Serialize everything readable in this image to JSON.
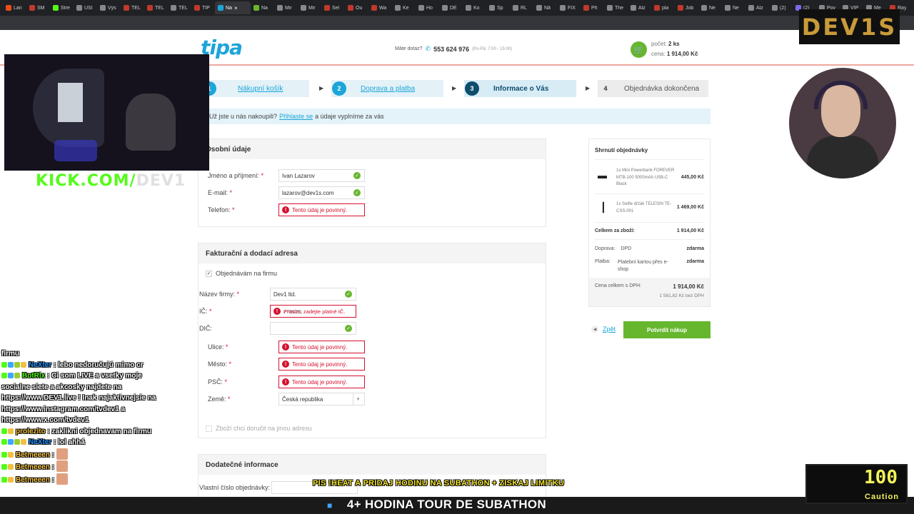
{
  "browser": {
    "tabs": [
      {
        "label": "Lan",
        "color": "#e94e1b"
      },
      {
        "label": "SM",
        "color": "#c0392b"
      },
      {
        "label": "Stre",
        "color": "#53fc18"
      },
      {
        "label": "USI",
        "color": "#888888"
      },
      {
        "label": "Výs",
        "color": "#888888"
      },
      {
        "label": "TEL",
        "color": "#c0392b"
      },
      {
        "label": "TEL",
        "color": "#c0392b"
      },
      {
        "label": "TEL",
        "color": "#888888"
      },
      {
        "label": "TIP",
        "color": "#c0392b"
      },
      {
        "label": "Na",
        "color": "#1ca5d8",
        "active": true
      },
      {
        "label": "Na",
        "color": "#67b72e"
      },
      {
        "label": "Mir",
        "color": "#888888"
      },
      {
        "label": "Mir",
        "color": "#888888"
      },
      {
        "label": "Sel",
        "color": "#c0392b"
      },
      {
        "label": "Ou",
        "color": "#c0392b"
      },
      {
        "label": "Wa",
        "color": "#c0392b"
      },
      {
        "label": "Ke",
        "color": "#888888"
      },
      {
        "label": "Ho",
        "color": "#888888"
      },
      {
        "label": "DE",
        "color": "#888888"
      },
      {
        "label": "Ko",
        "color": "#888888"
      },
      {
        "label": "Sp",
        "color": "#888888"
      },
      {
        "label": "RL",
        "color": "#888888"
      },
      {
        "label": "Nã",
        "color": "#888888"
      },
      {
        "label": "FIX",
        "color": "#888888"
      },
      {
        "label": "Při",
        "color": "#c0392b"
      },
      {
        "label": "The",
        "color": "#888888"
      },
      {
        "label": "Alz",
        "color": "#888888"
      },
      {
        "label": "pla",
        "color": "#c0392b"
      },
      {
        "label": "Job",
        "color": "#c0392b"
      },
      {
        "label": "Ne",
        "color": "#888888"
      },
      {
        "label": "Ne",
        "color": "#888888"
      },
      {
        "label": "Alz",
        "color": "#888888"
      },
      {
        "label": "(2)",
        "color": "#888888"
      },
      {
        "label": "(2)",
        "color": "#7b68ee"
      },
      {
        "label": "Pov",
        "color": "#888888"
      },
      {
        "label": "VIP",
        "color": "#888888"
      },
      {
        "label": "Me",
        "color": "#888888"
      },
      {
        "label": "Ray",
        "color": "#c0392b"
      }
    ],
    "active_tab_close": "×"
  },
  "site": {
    "logo": "tipa",
    "contact_label": "Máte dotaz?",
    "phone": "553 624 976",
    "hours": "(Po-Pá: 7:00 - 15:00)",
    "cart_count_label": "počet:",
    "cart_count": "2 ks",
    "cart_price_label": "cena:",
    "cart_price": "1 914,00 Kč"
  },
  "steps": [
    {
      "num": "1",
      "label": "Nákupní košík"
    },
    {
      "num": "2",
      "label": "Doprava a platba"
    },
    {
      "num": "3",
      "label": "Informace o Vás"
    },
    {
      "num": "4",
      "label": "Objednávka dokončena"
    }
  ],
  "login_bar": {
    "prefix": "Už jste u nás nakoupili?",
    "link": "Přihlaste se",
    "suffix": "a údaje vyplníme za vás"
  },
  "personal": {
    "title": "Osobní údaje",
    "name_label": "Jméno a příjmení:",
    "name_value": "Ivan Lazarov",
    "email_label": "E-mail:",
    "email_value": "lazarov@dev1s.com",
    "phone_label": "Telefon:",
    "phone_error": "Tento údaj je povinný."
  },
  "billing": {
    "title": "Fakturační a dodací adresa",
    "company_checkbox": "Objednávám na firmu",
    "company_label": "Název firmy:",
    "company_value": "Dev1 ltd.",
    "ico_label": "IČ:",
    "ico_value": "778620",
    "ico_error": "Prosím, zadejte platné IČ.",
    "dic_label": "DIČ:",
    "street_label": "Ulice:",
    "city_label": "Město:",
    "zip_label": "PSČ:",
    "required_error": "Tento údaj je povinný.",
    "country_label": "Země:",
    "country_value": "Česká republika",
    "other_address": "Zboží chci doručit na jinou adresu"
  },
  "additional": {
    "title": "Dodatečné informace",
    "order_number_label": "Vlastní číslo objednávky:"
  },
  "summary": {
    "title": "Shrnutí objednávky",
    "items": [
      {
        "name": "1x Mini Powerbank FOREVER MTB-100 5000mAh USB-C Black",
        "price": "445,00 Kč"
      },
      {
        "name": "1x Selfie držák TELESIN TE-CSS-001",
        "price": "1 469,00 Kč"
      }
    ],
    "goods_total_label": "Celkem za zboží:",
    "goods_total": "1 914,00 Kč",
    "shipping_label": "Doprava:",
    "shipping_method": "DPD",
    "shipping_price": "zdarma",
    "payment_label": "Platba:",
    "payment_method": "Platební kartou přes e-shop",
    "payment_price": "zdarma",
    "total_label": "Cena celkem s DPH:",
    "total": "1 914,00 Kč",
    "total_novat": "1 581,82 Kč bez DPH"
  },
  "actions": {
    "back": "Zpět",
    "confirm": "Potvrdit nákup"
  },
  "overlay": {
    "kick_green": "KICK.COM/",
    "kick_grey": "DEV1",
    "devis_logo": "DEV1S",
    "chat": [
      {
        "user": "",
        "text": "firmu",
        "badges": []
      },
      {
        "user": "NeXter",
        "text": ": lebo nedoručujú mimo cr",
        "user_color": "#1e90ff",
        "badges": [
          "#53fc18",
          "#3ea6ff",
          "#9acd32",
          "#f0c040"
        ]
      },
      {
        "user": "BotRix",
        "text": ": Ci som LIVE a vsetky moje socialne siete a akcosky najdete na https://www.DEV1.live ! Inak najaktivnejsie na https://www.instagram.com/tvdev1 a https://www.x.com/tvdev1",
        "user_color": "#53fc18",
        "badges": [
          "#53fc18",
          "#3ea6ff",
          "#9acd32"
        ]
      },
      {
        "user": "prolezito",
        "text": ": zaklikni objednavam na firmu",
        "user_color": "#f0c040",
        "badges": [
          "#53fc18",
          "#f0c040"
        ]
      },
      {
        "user": "NeXter",
        "text": ": lol ahhá",
        "user_color": "#1e90ff",
        "badges": [
          "#53fc18",
          "#3ea6ff",
          "#9acd32",
          "#f0c040"
        ]
      },
      {
        "user": "Betmeeen",
        "text": ":",
        "user_color": "#f0c040",
        "badges": [
          "#53fc18",
          "#f0c040"
        ],
        "emote": true
      },
      {
        "user": "Betmeeen",
        "text": ":",
        "user_color": "#f0c040",
        "badges": [
          "#53fc18",
          "#f0c040"
        ],
        "emote": true
      },
      {
        "user": "Betmeeen",
        "text": ":",
        "user_color": "#f0c040",
        "badges": [
          "#53fc18",
          "#f0c040"
        ],
        "emote": true
      }
    ],
    "ticker_mid": "PIS !HEAT A PRIDAJ HODINU NA SUBATHON + ZISKAJ LIMITKU",
    "ticker_big": "4+ HODINA TOUR DE SUBATHON",
    "caution_number": "100",
    "caution_label": "Caution"
  },
  "colors": {
    "brand_blue": "#1ca5d8",
    "confirm_green": "#67b72e",
    "error_red": "#d5112f"
  }
}
